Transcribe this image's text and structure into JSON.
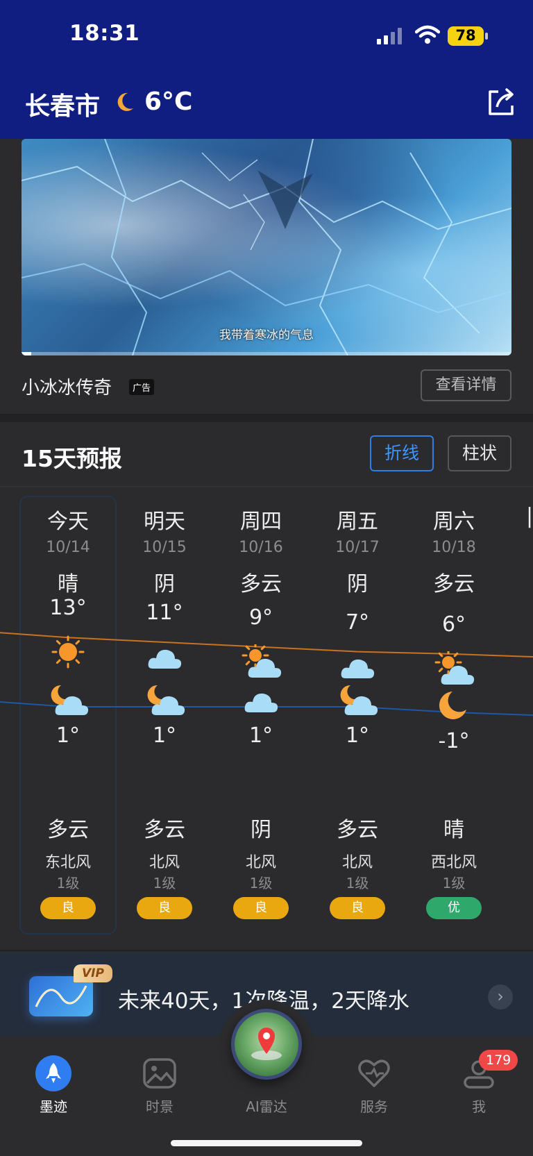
{
  "status_bar": {
    "time": "18:31",
    "battery": "78"
  },
  "header": {
    "city": "长春市",
    "temp": "6°C",
    "weather_icon": "moon-icon",
    "share_icon": "share-icon"
  },
  "ad": {
    "caption": "我带着寒冰的气息",
    "title": "小冰冰传奇",
    "tag": "广告",
    "detail_button": "查看详情"
  },
  "forecast": {
    "title": "15天预报",
    "tab_line": "折线",
    "tab_bar": "柱状",
    "days": [
      {
        "day": "今天",
        "date": "10/14",
        "day_weather": "晴",
        "high": "13°",
        "low": "1°",
        "night_weather": "多云",
        "wind": "东北风",
        "level": "1级",
        "aqi": "良",
        "aqi_color": "#e9a80f",
        "day_icon": "sun-icon",
        "night_icon": "moon-cloud-icon"
      },
      {
        "day": "明天",
        "date": "10/15",
        "day_weather": "阴",
        "high": "11°",
        "low": "1°",
        "night_weather": "多云",
        "wind": "北风",
        "level": "1级",
        "aqi": "良",
        "aqi_color": "#e9a80f",
        "day_icon": "cloud-icon",
        "night_icon": "moon-cloud-icon"
      },
      {
        "day": "周四",
        "date": "10/16",
        "day_weather": "多云",
        "high": "9°",
        "low": "1°",
        "night_weather": "阴",
        "wind": "北风",
        "level": "1级",
        "aqi": "良",
        "aqi_color": "#e9a80f",
        "day_icon": "sun-cloud-icon",
        "night_icon": "cloud-icon"
      },
      {
        "day": "周五",
        "date": "10/17",
        "day_weather": "阴",
        "high": "7°",
        "low": "1°",
        "night_weather": "多云",
        "wind": "北风",
        "level": "1级",
        "aqi": "良",
        "aqi_color": "#e9a80f",
        "day_icon": "cloud-icon",
        "night_icon": "moon-cloud-icon"
      },
      {
        "day": "周六",
        "date": "10/18",
        "day_weather": "多云",
        "high": "6°",
        "low": "-1°",
        "night_weather": "晴",
        "wind": "西北风",
        "level": "1级",
        "aqi": "优",
        "aqi_color": "#2fa86c",
        "day_icon": "sun-cloud-icon",
        "night_icon": "moon-icon"
      }
    ],
    "high_values": [
      13,
      11,
      9,
      7,
      6
    ],
    "low_values": [
      1,
      1,
      1,
      1,
      -1
    ],
    "high_line_color": "#c9731f",
    "low_line_color": "#1e56a8"
  },
  "vip": {
    "badge": "VIP",
    "text": "未来40天，1次降温，2天降水"
  },
  "nav": {
    "items": [
      {
        "label": "墨迹",
        "icon": "rocket-icon",
        "active": true
      },
      {
        "label": "时景",
        "icon": "photo-icon",
        "active": false
      },
      {
        "label": "AI雷达",
        "icon": "radar-icon",
        "active": false
      },
      {
        "label": "服务",
        "icon": "heart-icon",
        "active": false
      },
      {
        "label": "我",
        "icon": "user-icon",
        "active": false
      }
    ],
    "badge": "179"
  }
}
